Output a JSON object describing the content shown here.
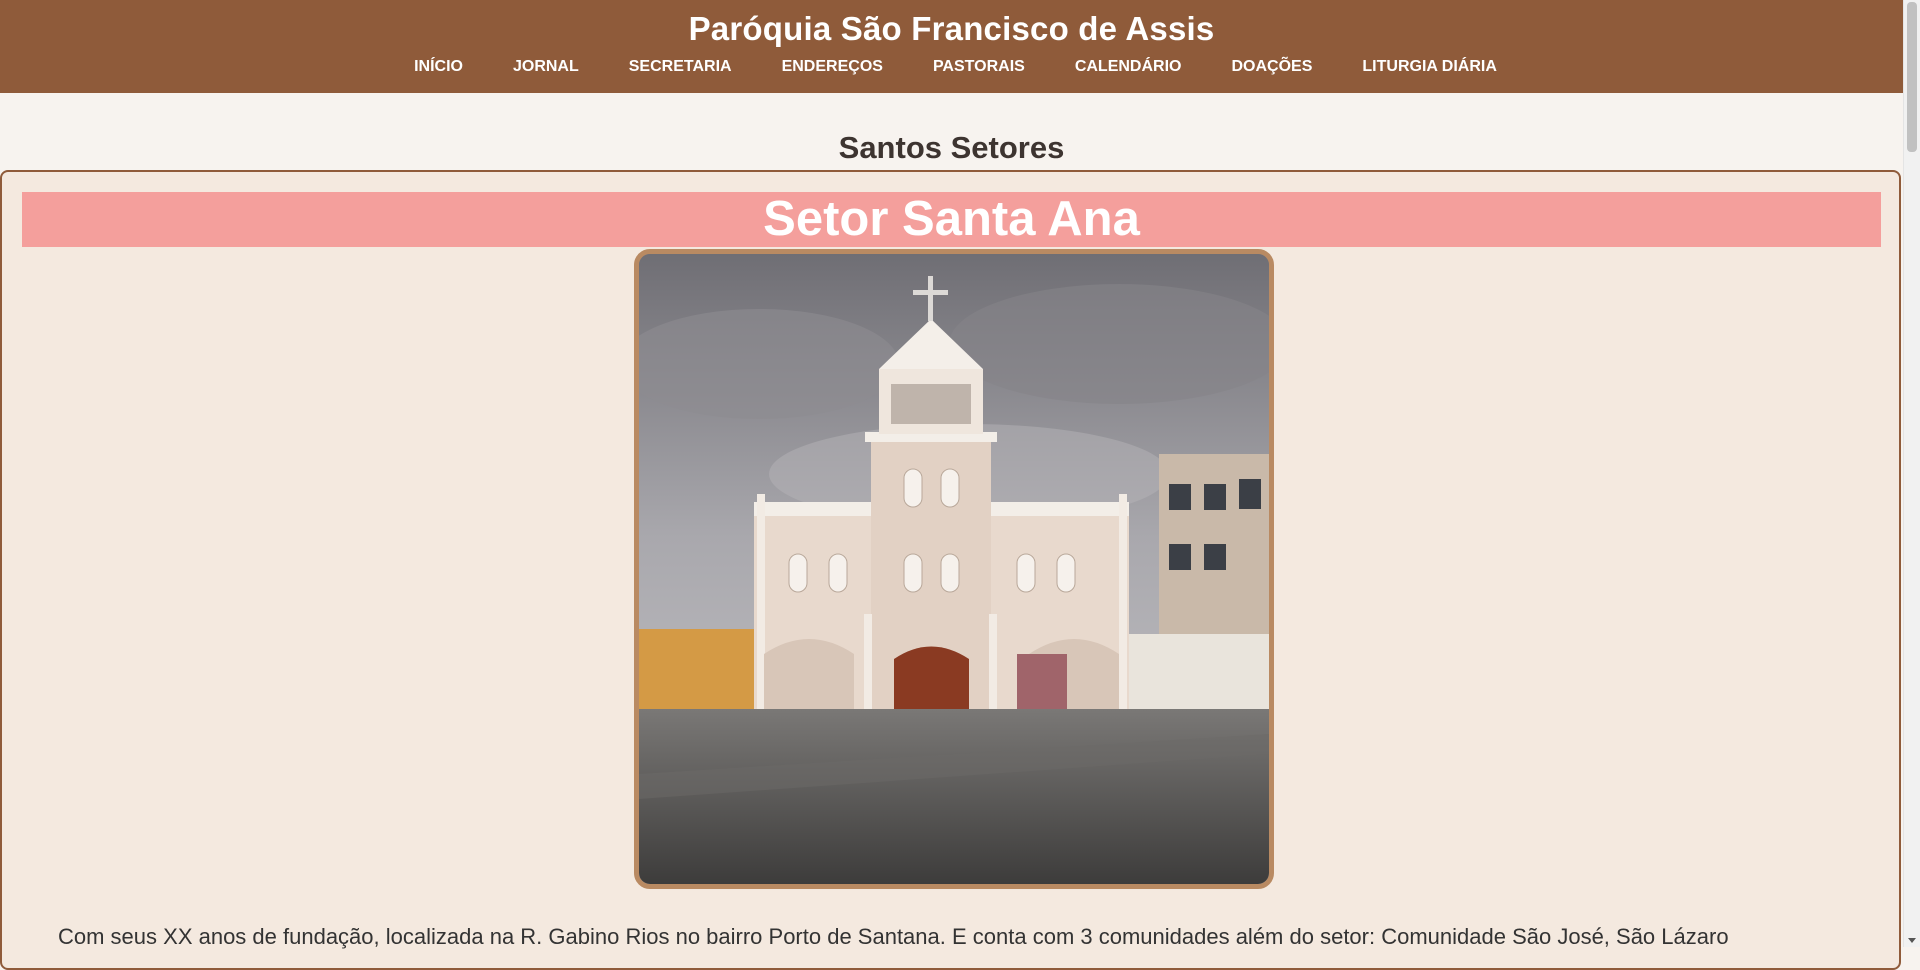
{
  "header": {
    "title": "Paróquia São Francisco de Assis",
    "nav": [
      {
        "label": "INÍCIO"
      },
      {
        "label": "JORNAL"
      },
      {
        "label": "SECRETARIA"
      },
      {
        "label": "ENDEREÇOS"
      },
      {
        "label": "PASTORAIS"
      },
      {
        "label": "CALENDÁRIO"
      },
      {
        "label": "DOAÇÕES"
      },
      {
        "label": "LITURGIA DIÁRIA"
      }
    ]
  },
  "main": {
    "heading": "Santos Setores",
    "sector": {
      "name": "Setor Santa Ana",
      "description": "Com seus XX anos de fundação, localizada na R. Gabino Rios no bairro Porto de Santana. E conta com 3 comunidades além do setor: Comunidade São José, São Lázaro"
    }
  },
  "colors": {
    "header_bg": "#8f5b3a",
    "page_bg": "#f7f3ef",
    "card_bg": "#f4e9df",
    "banner_bg": "#f49f9c",
    "photo_border": "#b98a62"
  }
}
